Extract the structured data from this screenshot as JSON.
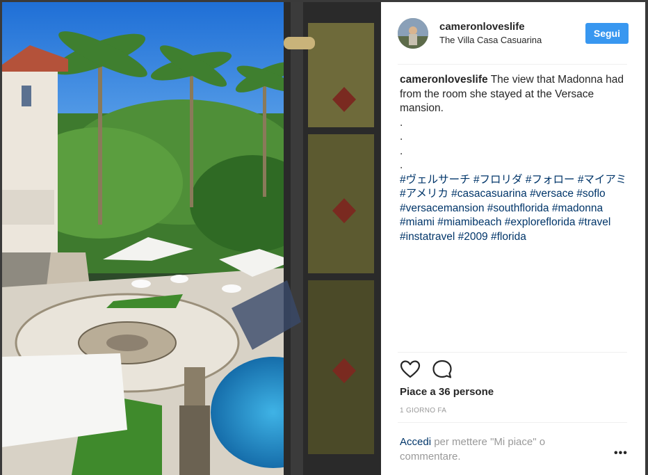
{
  "post": {
    "username": "cameronloveslife",
    "location": "The Villa Casa Casuarina",
    "follow_label": "Segui",
    "caption_user": "cameronloveslife",
    "caption_text": "The view that Madonna had from the room she stayed at the Versace mansion.",
    "caption_dots": [
      ".",
      ".",
      ".",
      "."
    ],
    "hashtags": [
      "#ヴェルサーチ",
      "#フロリダ",
      "#フォロー",
      "#マイアミ",
      "#アメリカ",
      "#casacasuarina",
      "#versace",
      "#soflo",
      "#versacemansion",
      "#southflorida",
      "#madonna",
      "#miami",
      "#miamibeach",
      "#exploreflorida",
      "#travel",
      "#instatravel",
      "#2009",
      "#florida"
    ],
    "likes_text": "Piace a 36 persone",
    "time_text": "1 GIORNO FA",
    "login_link": "Accedi",
    "login_text": " per mettere \"Mi piace\" o commentare.",
    "more_label": "•••"
  },
  "icons": {
    "like": "heart-icon",
    "comment": "comment-icon",
    "more": "more-options-icon"
  },
  "colors": {
    "follow_button": "#3897f0",
    "hashtag": "#003569",
    "muted": "#999999",
    "text": "#262626"
  }
}
